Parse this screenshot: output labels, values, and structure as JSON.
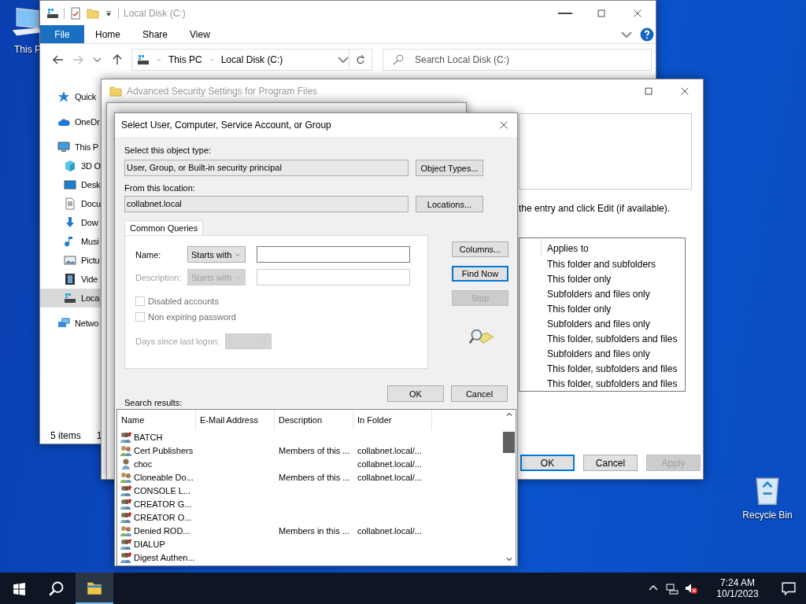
{
  "desktop": {
    "icons": [
      {
        "label": "This P",
        "kind": "computer"
      },
      {
        "label": "Recycle Bin",
        "kind": "recycle"
      }
    ]
  },
  "explorer": {
    "title": "Local Disk (C:)",
    "ribbon_tabs": [
      {
        "label": "File",
        "kind": "file"
      },
      {
        "label": "Home",
        "kind": "tab"
      },
      {
        "label": "Share",
        "kind": "tab"
      },
      {
        "label": "View",
        "kind": "tab"
      }
    ],
    "breadcrumb": [
      "This PC",
      "Local Disk (C:)"
    ],
    "search": {
      "placeholder": "Search Local Disk (C:)"
    },
    "nav": [
      {
        "label": "Quick",
        "kind": "star",
        "selected": false
      },
      {
        "label": "OneDr",
        "kind": "cloud",
        "selected": false
      },
      {
        "label": "This P",
        "kind": "pc",
        "selected": false,
        "children": [
          {
            "label": "3D O",
            "kind": "cube",
            "selected": false
          },
          {
            "label": "Desk",
            "kind": "desktop",
            "selected": false
          },
          {
            "label": "Docu",
            "kind": "doc",
            "selected": false
          },
          {
            "label": "Dow",
            "kind": "download",
            "selected": false
          },
          {
            "label": "Musi",
            "kind": "music",
            "selected": false
          },
          {
            "label": "Pictu",
            "kind": "picture",
            "selected": false
          },
          {
            "label": "Vide",
            "kind": "video",
            "selected": false
          },
          {
            "label": "Loca",
            "kind": "drive",
            "selected": true
          }
        ]
      },
      {
        "label": "Netwo",
        "kind": "network",
        "selected": false
      }
    ],
    "status": [
      "5 items",
      "1"
    ]
  },
  "security": {
    "title": "Advanced Security Settings for Program Files",
    "hint": "the entry and click Edit (if available).",
    "table": {
      "columns": [
        "Applies to"
      ],
      "rows": [
        "This folder and subfolders",
        "This folder only",
        "Subfolders and files only",
        "This folder only",
        "Subfolders and files only",
        "This folder, subfolders and files",
        "Subfolders and files only",
        "This folder, subfolders and files",
        "This folder, subfolders and files"
      ]
    },
    "buttons": [
      {
        "label": "OK",
        "kind": "default"
      },
      {
        "label": "Cancel",
        "kind": "normal"
      },
      {
        "label": "Apply",
        "kind": "disabled"
      }
    ]
  },
  "dialog": {
    "title": "Select User, Computer, Service Account, or Group",
    "object_type": {
      "label": "Select this object type:",
      "value": "User, Group, or Built-in security principal",
      "button": "Object Types..."
    },
    "location": {
      "label": "From this location:",
      "value": "collabnet.local",
      "button": "Locations..."
    },
    "query_tab": "Common Queries",
    "fields": [
      {
        "label": "Name:",
        "mode": "Starts with",
        "disabled": false
      },
      {
        "label": "Description:",
        "mode": "Starts with",
        "disabled": true
      }
    ],
    "checkboxes": [
      {
        "label": "Disabled accounts",
        "checked": false
      },
      {
        "label": "Non expiring password",
        "checked": false
      }
    ],
    "days": {
      "label": "Days since last logon:",
      "disabled": true
    },
    "side_buttons": [
      {
        "label": "Columns...",
        "kind": "normal"
      },
      {
        "label": "Find Now",
        "kind": "default"
      },
      {
        "label": "Stop",
        "kind": "disabled"
      }
    ],
    "buttons": [
      {
        "label": "OK",
        "kind": "normal"
      },
      {
        "label": "Cancel",
        "kind": "normal"
      }
    ],
    "results_label": "Search results:",
    "results": {
      "columns": [
        "Name",
        "E-Mail Address",
        "Description",
        "In Folder"
      ],
      "rows": [
        {
          "name": "BATCH",
          "kind": "special"
        },
        {
          "name": "Cert Publishers",
          "description": "Members of this ...",
          "folder": "collabnet.local/...",
          "kind": "group"
        },
        {
          "name": "choc",
          "folder": "collabnet.local/...",
          "kind": "user"
        },
        {
          "name": "Cloneable Do...",
          "description": "Members of this ...",
          "folder": "collabnet.local/...",
          "kind": "group"
        },
        {
          "name": "CONSOLE L...",
          "kind": "special"
        },
        {
          "name": "CREATOR G...",
          "kind": "special"
        },
        {
          "name": "CREATOR O...",
          "kind": "special"
        },
        {
          "name": "Denied ROD...",
          "description": "Members in this ...",
          "folder": "collabnet.local/...",
          "kind": "group"
        },
        {
          "name": "DIALUP",
          "kind": "special"
        },
        {
          "name": "Digest Authen...",
          "kind": "special"
        }
      ]
    }
  },
  "taskbar": {
    "apps": [
      {
        "kind": "start",
        "active": false
      },
      {
        "kind": "search",
        "active": false
      },
      {
        "kind": "explorer",
        "active": true
      }
    ],
    "tray": [
      {
        "kind": "chevron"
      },
      {
        "kind": "network"
      },
      {
        "kind": "volume-muted"
      }
    ],
    "time": "7:24 AM",
    "date": "10/1/2023"
  }
}
